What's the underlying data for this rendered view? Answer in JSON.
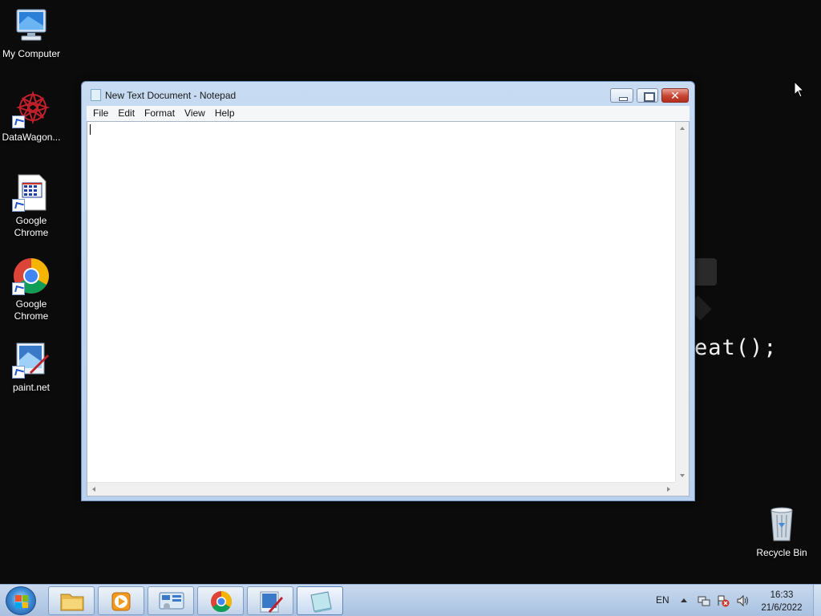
{
  "desktop": {
    "background_text": "eat();",
    "icons": [
      {
        "label": "My Computer",
        "icon": "computer-icon"
      },
      {
        "label": "DataWagon...",
        "icon": "datawagon-icon"
      },
      {
        "label": "Google Chrome",
        "icon": "document-shortcut-icon"
      },
      {
        "label": "Google Chrome",
        "icon": "chrome-icon"
      },
      {
        "label": "paint.net",
        "icon": "paintnet-icon"
      },
      {
        "label": "Recycle Bin",
        "icon": "recycle-bin-icon"
      }
    ]
  },
  "notepad": {
    "title": "New Text Document - Notepad",
    "menu": [
      "File",
      "Edit",
      "Format",
      "View",
      "Help"
    ],
    "content": ""
  },
  "taskbar": {
    "apps": [
      {
        "icon": "file-explorer-icon"
      },
      {
        "icon": "media-player-icon"
      },
      {
        "icon": "control-panel-icon"
      },
      {
        "icon": "chrome-icon"
      },
      {
        "icon": "paintnet-icon"
      },
      {
        "icon": "notepad-icon"
      }
    ],
    "tray": {
      "language": "EN",
      "time": "16:33",
      "date": "21/6/2022"
    }
  },
  "colors": {
    "desktop_bg": "#0b0b0b",
    "window_frame": "#b9d1ee",
    "close_button": "#c74432"
  }
}
